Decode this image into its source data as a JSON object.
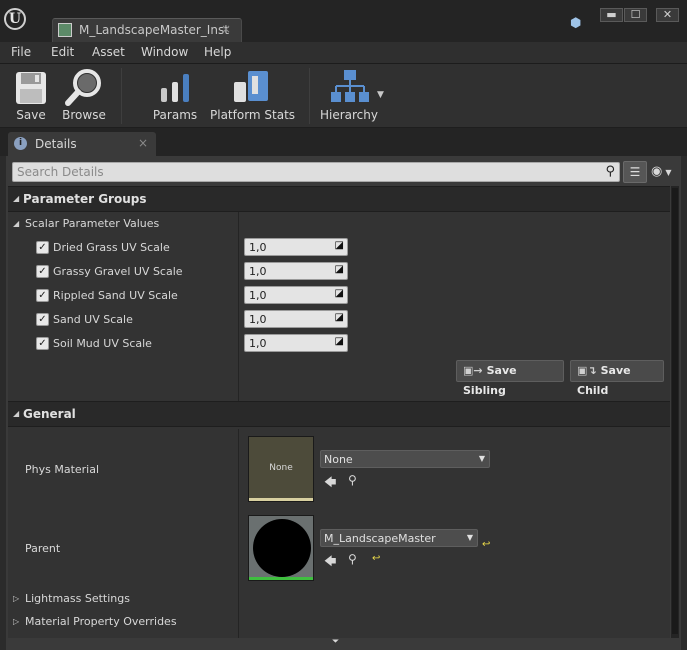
{
  "window": {
    "tab_title": "M_LandscapeMaster_Inst",
    "tab_close": "×",
    "minimize": "▬",
    "maximize": "☐",
    "close": "✕"
  },
  "menu": [
    "File",
    "Edit",
    "Asset",
    "Window",
    "Help"
  ],
  "toolbar": {
    "save": "Save",
    "browse": "Browse",
    "params": "Params",
    "platform_stats": "Platform Stats",
    "hierarchy": "Hierarchy"
  },
  "details_tab": {
    "label": "Details",
    "close": "×"
  },
  "search": {
    "placeholder": "Search Details"
  },
  "parameter_groups": {
    "title": "Parameter Groups",
    "subcategory": "Scalar Parameter Values",
    "params": [
      {
        "name": "Dried Grass UV Scale",
        "value": "1,0",
        "checked": true
      },
      {
        "name": "Grassy Gravel UV Scale",
        "value": "1,0",
        "checked": true
      },
      {
        "name": "Rippled Sand UV Scale",
        "value": "1,0",
        "checked": true
      },
      {
        "name": "Sand UV Scale",
        "value": "1,0",
        "checked": true
      },
      {
        "name": "Soil Mud UV Scale",
        "value": "1,0",
        "checked": true
      }
    ],
    "save_sibling": "Save Sibling",
    "save_child": "Save Child"
  },
  "general": {
    "title": "General",
    "phys_material": {
      "label": "Phys Material",
      "thumb_text": "None",
      "value": "None"
    },
    "parent": {
      "label": "Parent",
      "value": "M_LandscapeMaster"
    },
    "lightmass": "Lightmass Settings",
    "material_overrides": "Material Property Overrides"
  },
  "colors": {
    "accent_green": "#3fbf3f",
    "reset_yellow": "#e8d84a",
    "panel_bg": "#3a3a3a"
  }
}
